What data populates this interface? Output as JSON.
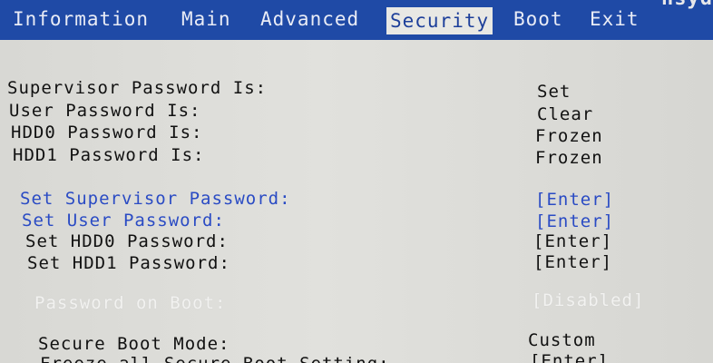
{
  "tabs": [
    {
      "label": "Information"
    },
    {
      "label": "Main"
    },
    {
      "label": "Advanced"
    },
    {
      "label": "Security"
    },
    {
      "label": "Boot"
    },
    {
      "label": "Exit"
    }
  ],
  "brand": "nsyd",
  "status_rows": [
    {
      "label": "Supervisor Password Is:",
      "value": "Set"
    },
    {
      "label": "User Password Is:",
      "value": "Clear"
    },
    {
      "label": "HDD0 Password Is:",
      "value": "Frozen"
    },
    {
      "label": "HDD1 Password Is:",
      "value": "Frozen"
    }
  ],
  "action_rows": [
    {
      "label": "Set Supervisor Password:",
      "value": "[Enter]"
    },
    {
      "label": "Set User Password:",
      "value": "[Enter]"
    },
    {
      "label": "Set HDD0 Password:",
      "value": "[Enter]"
    },
    {
      "label": "Set HDD1 Password:",
      "value": "[Enter]"
    }
  ],
  "password_on_boot": {
    "label": "Password on Boot:",
    "value": "[Disabled]"
  },
  "secure_boot_mode": {
    "label": "Secure Boot Mode:",
    "value": "Custom"
  },
  "freeze_row": {
    "label": "Freeze all Secure Boot Setting:",
    "value": "[Enter]"
  },
  "colors": {
    "menu_bar": "#1f4aa6",
    "highlight_text": "#2a4bc4",
    "background": "#dcdcd8"
  }
}
